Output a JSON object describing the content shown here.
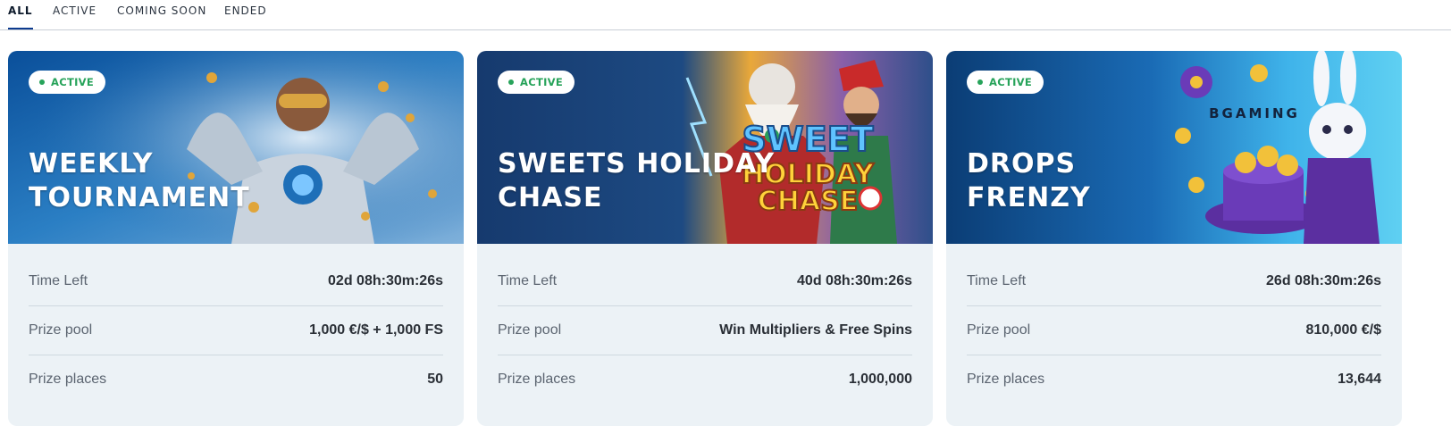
{
  "tabs": [
    {
      "label": "ALL",
      "active": true
    },
    {
      "label": "ACTIVE",
      "active": false
    },
    {
      "label": "COMING SOON",
      "active": false
    },
    {
      "label": "ENDED",
      "active": false
    }
  ],
  "cards": [
    {
      "badge": "ACTIVE",
      "title_line1": "WEEKLY",
      "title_line2": "TOURNAMENT",
      "rows": [
        {
          "label": "Time Left",
          "value": "02d 08h:30m:26s"
        },
        {
          "label": "Prize pool",
          "value": "1,000 €/$ + 1,000 FS"
        },
        {
          "label": "Prize places",
          "value": "50"
        }
      ]
    },
    {
      "badge": "ACTIVE",
      "title_line1": "SWEETS HOLIDAY",
      "title_line2": "CHASE",
      "banner_logo_top": "SWEET",
      "banner_logo_bottom1": "HOLIDAY",
      "banner_logo_bottom2": "CHASE",
      "rows": [
        {
          "label": "Time Left",
          "value": "40d 08h:30m:26s"
        },
        {
          "label": "Prize pool",
          "value": "Win Multipliers & Free Spins"
        },
        {
          "label": "Prize places",
          "value": "1,000,000"
        }
      ]
    },
    {
      "badge": "ACTIVE",
      "title_line1": "DROPS",
      "title_line2": "FRENZY",
      "banner_brand": "BGAMING",
      "rows": [
        {
          "label": "Time Left",
          "value": "26d 08h:30m:26s"
        },
        {
          "label": "Prize pool",
          "value": "810,000 €/$"
        },
        {
          "label": "Prize places",
          "value": "13,644"
        }
      ]
    }
  ],
  "colors": {
    "tab_active_underline": "#0d3b8e",
    "badge_green": "#27a35a",
    "card_body": "#ecf2f6",
    "banner_blue": "#0c5aa6"
  },
  "icons": [
    "status-dot-icon",
    "hero-illustration",
    "santa-illustration",
    "rabbit-illustration"
  ]
}
